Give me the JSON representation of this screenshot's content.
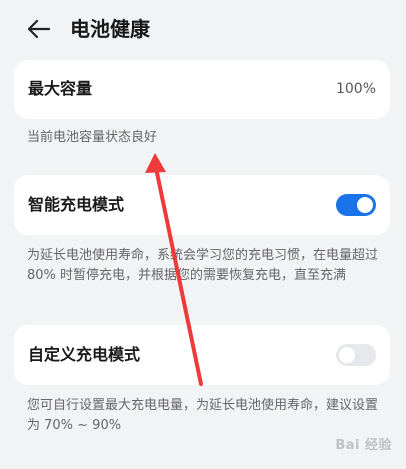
{
  "header": {
    "title": "电池健康"
  },
  "max_capacity": {
    "label": "最大容量",
    "value": "100%",
    "description": "当前电池容量状态良好"
  },
  "smart_charging": {
    "label": "智能充电模式",
    "enabled": true,
    "description": "为延长电池使用寿命，系统会学习您的充电习惯，在电量超过 80% 时暂停充电，并根据您的需要恢复充电，直至充满"
  },
  "custom_charging": {
    "label": "自定义充电模式",
    "enabled": false,
    "description": "您可自行设置最大充电电量，为延长电池使用寿命，建议设置为 70% ~ 90%"
  },
  "colors": {
    "accent": "#1a73e8",
    "annotation_arrow": "#ee3a3a"
  },
  "watermark": "Bai 经验"
}
